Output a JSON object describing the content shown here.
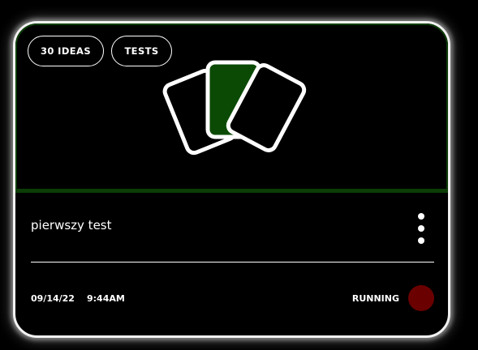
{
  "card": {
    "tags": [
      {
        "label": "30 IDEAS"
      },
      {
        "label": "TESTS"
      }
    ],
    "art_icon": "card-stack-icon",
    "title": "pierwszy test",
    "menu_icon": "more-vertical-icon",
    "date": "09/14/22",
    "time": "9:44AM",
    "status": "RUNNING",
    "colors": {
      "hero_border": "#0c3d06",
      "card_fill_accent": "#0b4a05",
      "status_dot": "#6b0000",
      "outline": "#ffffff"
    }
  }
}
